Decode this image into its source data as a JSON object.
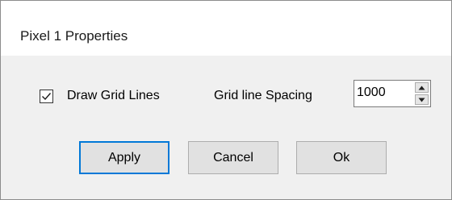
{
  "window": {
    "title": "Pixel 1 Properties"
  },
  "grid": {
    "draw_grid_lines_label": "Draw Grid Lines",
    "draw_grid_lines_checked": true,
    "spacing_label": "Grid line Spacing",
    "spacing_value": "1000"
  },
  "buttons": {
    "apply": "Apply",
    "cancel": "Cancel",
    "ok": "Ok"
  },
  "colors": {
    "focus_border": "#0078d7",
    "dialog_background": "#f0f0f0",
    "titlebar_background": "#ffffff"
  },
  "icons": {
    "checkbox": "checkmark-icon",
    "spin_up": "triangle-up-icon",
    "spin_down": "triangle-down-icon"
  }
}
